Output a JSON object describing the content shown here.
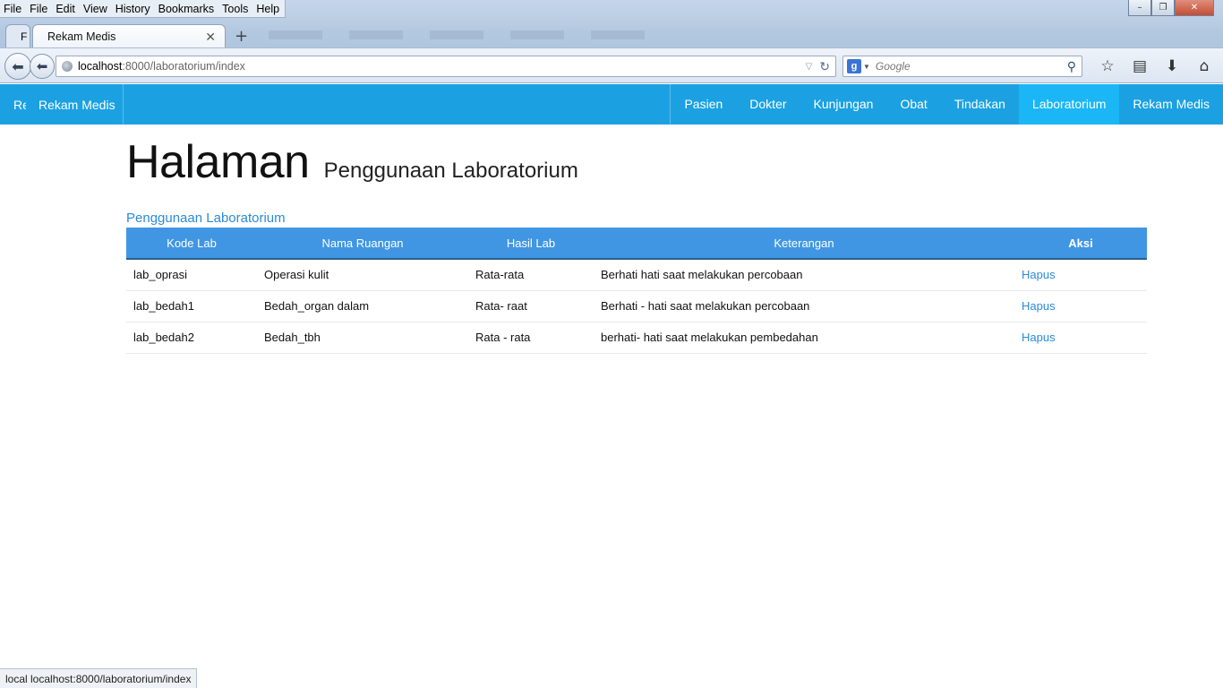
{
  "browser": {
    "menu": [
      "File",
      "File",
      "Edit",
      "View",
      "History",
      "Bookmarks",
      "Tools",
      "Help"
    ],
    "tabs": {
      "prev_label": "F",
      "active_title": "Rekam Medis",
      "close": "✕",
      "new_tab": "+"
    },
    "url": {
      "host": "localhost",
      "path": ":8000/laboratorium/index"
    },
    "search": {
      "engine_letter": "g",
      "placeholder": "Google"
    },
    "window_controls": [
      "–",
      "❐",
      "✕"
    ],
    "status_text": "local localhost:8000/laboratorium/index"
  },
  "app": {
    "brand_cut": "Re",
    "brand": "Rekam Medis",
    "nav": [
      "Pasien",
      "Dokter",
      "Kunjungan",
      "Obat",
      "Tindakan",
      "Laboratorium",
      "Rekam Medis"
    ],
    "active_nav": "Laboratorium"
  },
  "page": {
    "title": "Halaman",
    "subtitle": "Penggunaan Laboratorium",
    "link": "Penggunaan Laboratorium"
  },
  "table": {
    "columns": [
      "Kode Lab",
      "Nama Ruangan",
      "Hasil Lab",
      "Keterangan",
      "Aksi"
    ],
    "rows": [
      [
        "lab_oprasi",
        "Operasi kulit",
        "Rata-rata",
        "Berhati hati saat melakukan percobaan",
        "Hapus"
      ],
      [
        "lab_bedah1",
        "Bedah_organ dalam",
        "Rata- raat",
        "Berhati - hati saat melakukan percobaan",
        "Hapus"
      ],
      [
        "lab_bedah2",
        "Bedah_tbh",
        "Rata - rata",
        "berhati- hati saat melakukan pembedahan",
        "Hapus"
      ]
    ]
  },
  "colors": {
    "navbar": "#1ba1e2",
    "navbar_active": "#1ab6f5",
    "table_header": "#4096e3",
    "link": "#2b8ad8"
  }
}
